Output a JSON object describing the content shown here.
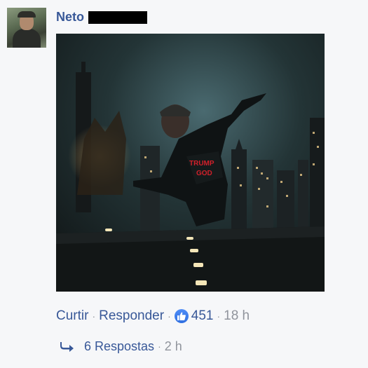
{
  "comment": {
    "author_name": "Neto",
    "author_surname_redacted": true,
    "photo_text": "TRUMP GOD",
    "actions": {
      "like_label": "Curtir",
      "reply_label": "Responder",
      "separator": "·",
      "reaction_count": "451",
      "timestamp": "18 h"
    },
    "replies": {
      "label": "6 Respostas",
      "timestamp": "2 h"
    }
  },
  "icons": {
    "reaction": "like-thumb-icon",
    "reply": "reply-arrow-icon"
  },
  "colors": {
    "link": "#385898",
    "muted": "#90949c",
    "background": "#f6f7f9",
    "like_badge": "#3b7af0"
  }
}
